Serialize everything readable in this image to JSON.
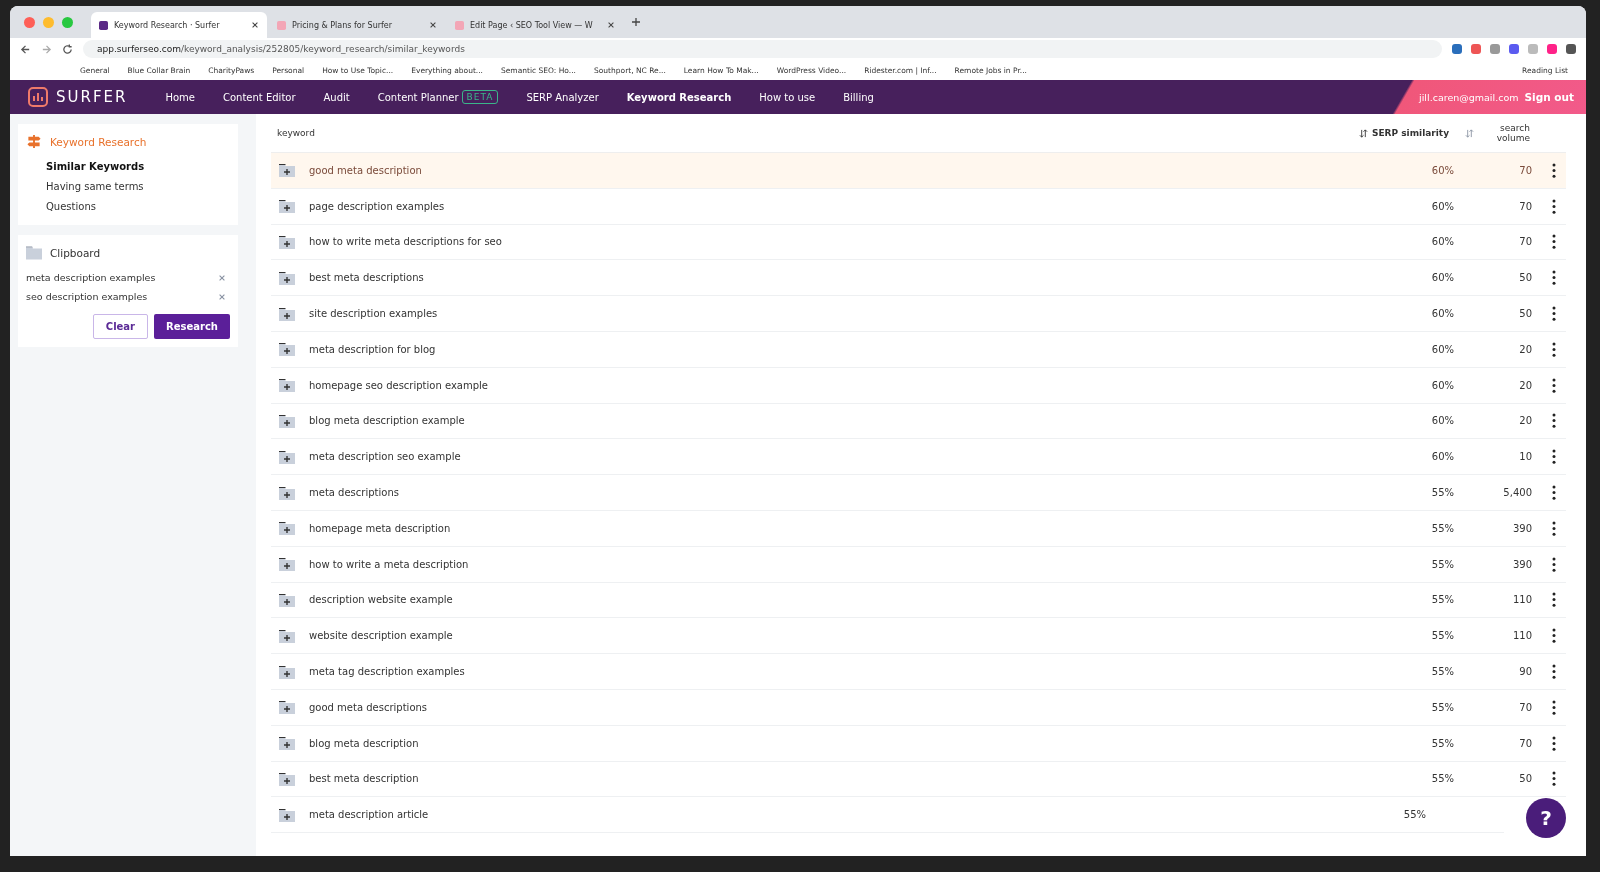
{
  "browser": {
    "tabs": [
      {
        "title": "Keyword Research · Surfer",
        "selected": true
      },
      {
        "title": "Pricing & Plans for Surfer",
        "selected": false
      },
      {
        "title": "Edit Page ‹ SEO Tool View — W",
        "selected": false
      }
    ],
    "url_host": "app.surferseo.com",
    "url_path": "/keyword_analysis/252805/keyword_research/similar_keywords",
    "bookmarks": [
      "General",
      "Blue Collar Brain",
      "CharityPaws",
      "Personal",
      "How to Use Topic...",
      "Everything about...",
      "Semantic SEO: Ho...",
      "Southport, NC Re...",
      "Learn How To Mak...",
      "WordPress Video...",
      "Ridester.com | Inf...",
      "Remote Jobs in Pr..."
    ],
    "reading_list": "Reading List"
  },
  "nav": {
    "logo": "SURFER",
    "items": [
      {
        "label": "Home",
        "selected": false
      },
      {
        "label": "Content Editor",
        "selected": false
      },
      {
        "label": "Audit",
        "selected": false
      },
      {
        "label": "Content Planner",
        "badge": "BETA",
        "selected": false
      },
      {
        "label": "SERP Analyzer",
        "selected": false
      },
      {
        "label": "Keyword Research",
        "selected": true
      },
      {
        "label": "How to use",
        "selected": false
      },
      {
        "label": "Billing",
        "selected": false
      }
    ],
    "email": "jill.caren@gmail.com",
    "sign_out": "Sign out"
  },
  "sidebar": {
    "title": "Keyword Research",
    "items": [
      {
        "label": "Similar Keywords",
        "selected": true
      },
      {
        "label": "Having same terms",
        "selected": false
      },
      {
        "label": "Questions",
        "selected": false
      }
    ],
    "clipboard": {
      "title": "Clipboard",
      "items": [
        "meta description examples",
        "seo description examples"
      ],
      "clear": "Clear",
      "research": "Research"
    }
  },
  "table": {
    "columns": [
      "keyword",
      "SERP similarity",
      "search volume"
    ],
    "rows": [
      {
        "keyword": "good meta description",
        "similarity": "60%",
        "volume": "70",
        "highlighted": true
      },
      {
        "keyword": "page description examples",
        "similarity": "60%",
        "volume": "70",
        "highlighted": false
      },
      {
        "keyword": "how to write meta descriptions for seo",
        "similarity": "60%",
        "volume": "70",
        "highlighted": false
      },
      {
        "keyword": "best meta descriptions",
        "similarity": "60%",
        "volume": "50",
        "highlighted": false
      },
      {
        "keyword": "site description examples",
        "similarity": "60%",
        "volume": "50",
        "highlighted": false
      },
      {
        "keyword": "meta description for blog",
        "similarity": "60%",
        "volume": "20",
        "highlighted": false
      },
      {
        "keyword": "homepage seo description example",
        "similarity": "60%",
        "volume": "20",
        "highlighted": false
      },
      {
        "keyword": "blog meta description example",
        "similarity": "60%",
        "volume": "20",
        "highlighted": false
      },
      {
        "keyword": "meta description seo example",
        "similarity": "60%",
        "volume": "10",
        "highlighted": false
      },
      {
        "keyword": "meta descriptions",
        "similarity": "55%",
        "volume": "5,400",
        "highlighted": false
      },
      {
        "keyword": "homepage meta description",
        "similarity": "55%",
        "volume": "390",
        "highlighted": false
      },
      {
        "keyword": "how to write a meta description",
        "similarity": "55%",
        "volume": "390",
        "highlighted": false
      },
      {
        "keyword": "description website example",
        "similarity": "55%",
        "volume": "110",
        "highlighted": false
      },
      {
        "keyword": "website description example",
        "similarity": "55%",
        "volume": "110",
        "highlighted": false
      },
      {
        "keyword": "meta tag description examples",
        "similarity": "55%",
        "volume": "90",
        "highlighted": false
      },
      {
        "keyword": "good meta descriptions",
        "similarity": "55%",
        "volume": "70",
        "highlighted": false
      },
      {
        "keyword": "blog meta description",
        "similarity": "55%",
        "volume": "70",
        "highlighted": false
      },
      {
        "keyword": "best meta description",
        "similarity": "55%",
        "volume": "50",
        "highlighted": false
      },
      {
        "keyword": "meta description article",
        "similarity": "55%",
        "volume": "",
        "highlighted": false
      }
    ]
  },
  "help": "?"
}
